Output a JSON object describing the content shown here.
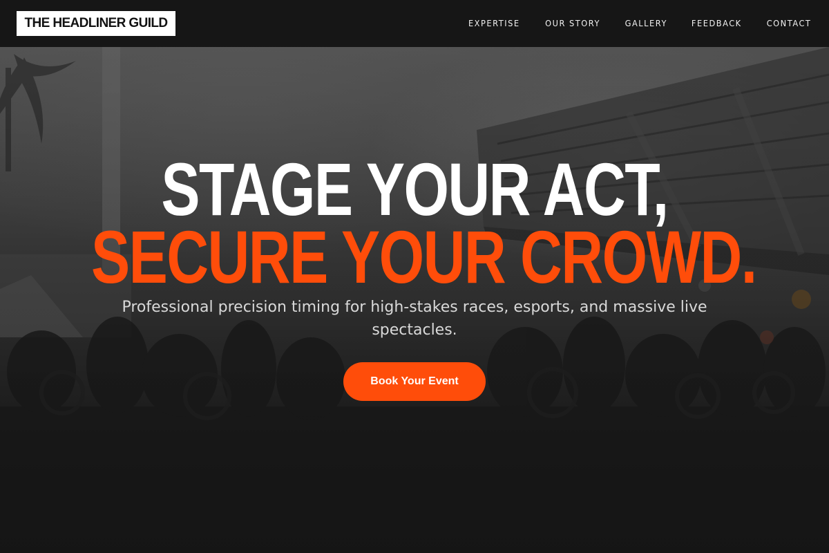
{
  "brand": {
    "logo_text": "THE HEADLINER GUILD"
  },
  "nav": {
    "items": [
      {
        "label": "EXPERTISE"
      },
      {
        "label": "OUR STORY"
      },
      {
        "label": "GALLERY"
      },
      {
        "label": "FEEDBACK"
      },
      {
        "label": "CONTACT"
      }
    ]
  },
  "hero": {
    "headline_line1": "STAGE YOUR ACT,",
    "headline_line2": "SECURE YOUR CROWD.",
    "subtitle": "Professional precision timing for high-stakes races, esports, and massive live spectacles.",
    "cta_label": "Book Your Event",
    "background_image": "stadium-crowd-photo"
  },
  "colors": {
    "accent": "#ff4d0a",
    "header_bg": "#161616",
    "logo_bg": "#ffffff",
    "text_light": "#ffffff"
  }
}
